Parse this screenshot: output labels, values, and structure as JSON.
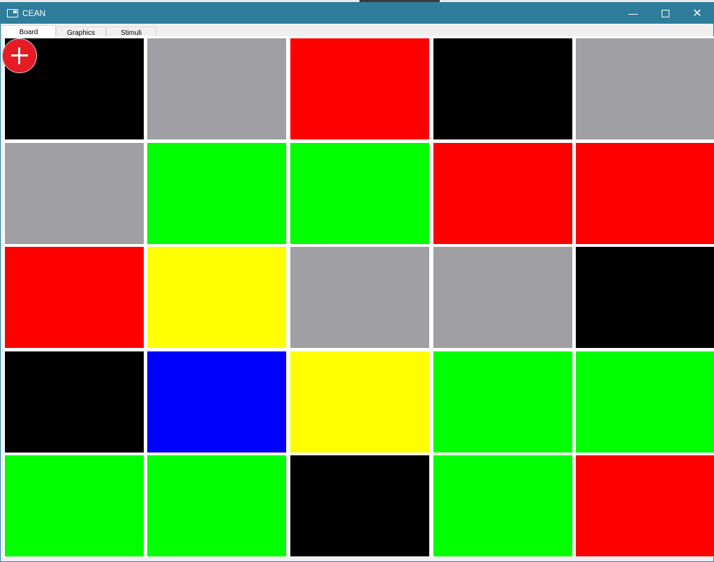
{
  "window": {
    "title": "CEAN",
    "minimize_icon": "minimize-icon",
    "maximize_icon": "maximize-icon",
    "close_icon": "close-icon"
  },
  "tabs": [
    {
      "label": "Board",
      "active": true
    },
    {
      "label": "Graphics",
      "active": false
    },
    {
      "label": "Stimuli",
      "active": false
    }
  ],
  "fab": {
    "icon": "plus-icon",
    "color": "#e51c23"
  },
  "palette": {
    "black": "#000000",
    "gray": "#a09fa3",
    "red": "#ff0000",
    "green": "#00ff00",
    "yellow": "#ffff00",
    "blue": "#0000ff"
  },
  "board": {
    "rows": [
      [
        "black",
        "gray",
        "red",
        "black",
        "gray"
      ],
      [
        "gray",
        "green",
        "green",
        "red",
        "red"
      ],
      [
        "red",
        "yellow",
        "gray",
        "gray",
        "black"
      ],
      [
        "black",
        "blue",
        "yellow",
        "green",
        "green"
      ],
      [
        "green",
        "green",
        "black",
        "green",
        "red"
      ]
    ]
  }
}
